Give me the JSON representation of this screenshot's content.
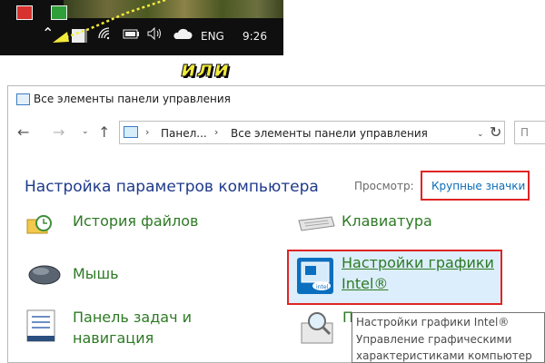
{
  "taskbar": {
    "language": "ENG",
    "time": "9:26",
    "icons": [
      "red-app-icon",
      "green-app-icon",
      "show-hidden-icons-caret",
      "app-icon",
      "wifi-icon",
      "battery-icon",
      "volume-icon",
      "cloud-icon"
    ],
    "arrow_color": "#f3eb3c"
  },
  "annotation": {
    "or_label": "или"
  },
  "window": {
    "title": "Все элементы панели управления",
    "address": {
      "crumbs": [
        "Панел...",
        "Все элементы панели управления"
      ]
    },
    "search_placeholder": "П",
    "page_title": "Настройка параметров компьютера",
    "view": {
      "label": "Просмотр:",
      "value": "Крупные значки"
    },
    "items": [
      {
        "label": "История файлов",
        "icon": "file-history-icon"
      },
      {
        "label": "Клавиатура",
        "icon": "keyboard-icon"
      },
      {
        "label": "Мышь",
        "icon": "mouse-icon"
      },
      {
        "label_line1": "Настройки графики",
        "label_line2": "Intel®",
        "icon": "intel-graphics-icon",
        "hovered": true
      },
      {
        "label_line1": "Панель задач и",
        "label_line2": "навигация",
        "icon": "taskbar-navigation-icon"
      },
      {
        "label": "П",
        "icon": "troubleshooting-icon"
      }
    ],
    "tooltip": {
      "line1": "Настройки графики Intel®",
      "line2": "Управление графическими",
      "line3": "характеристиками компьютер"
    }
  },
  "colors": {
    "link_green": "#2d7a24",
    "title_blue": "#1e3a8a",
    "view_blue": "#0a6db7",
    "highlight_red": "#e02424",
    "hover_bg": "#dceefb"
  }
}
